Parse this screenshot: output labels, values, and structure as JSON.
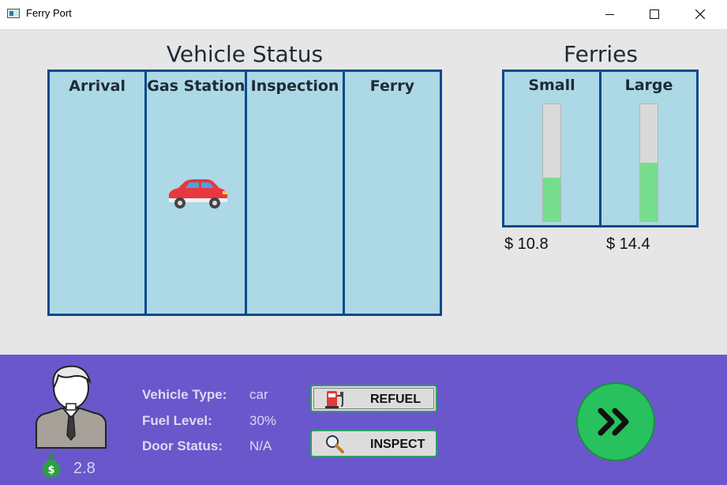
{
  "window": {
    "title": "Ferry Port",
    "controls": [
      "minimize",
      "maximize",
      "close"
    ]
  },
  "vehicle_status": {
    "title": "Vehicle Status",
    "columns": [
      "Arrival",
      "Gas Station",
      "Inspection",
      "Ferry"
    ],
    "vehicles": [
      {
        "type": "car",
        "column": "Gas Station",
        "icon": "red-car-icon",
        "color": "#e8373f"
      }
    ]
  },
  "ferries": {
    "title": "Ferries",
    "items": [
      {
        "name": "Small",
        "fill_fraction": 0.37,
        "price": "$ 10.8"
      },
      {
        "name": "Large",
        "fill_fraction": 0.5,
        "price": "$ 14.4"
      }
    ],
    "gauge_color": "#77dd8e"
  },
  "player": {
    "money": "2.8",
    "money_icon": "money-bag-icon"
  },
  "vehicle_info": {
    "type_label": "Vehicle Type:",
    "type_value": "car",
    "fuel_label": "Fuel Level:",
    "fuel_value": "30%",
    "door_label": "Door Status:",
    "door_value": "N/A"
  },
  "actions": {
    "refuel_label": "REFUEL",
    "refuel_icon": "fuel-pump-icon",
    "inspect_label": "INSPECT",
    "inspect_icon": "magnifier-icon",
    "next_icon": "fast-forward-icon"
  },
  "colors": {
    "board_bg": "#add8e6",
    "board_border": "#0b4a8a",
    "bottom_panel": "#6a57cc",
    "next_button": "#27c15e"
  }
}
